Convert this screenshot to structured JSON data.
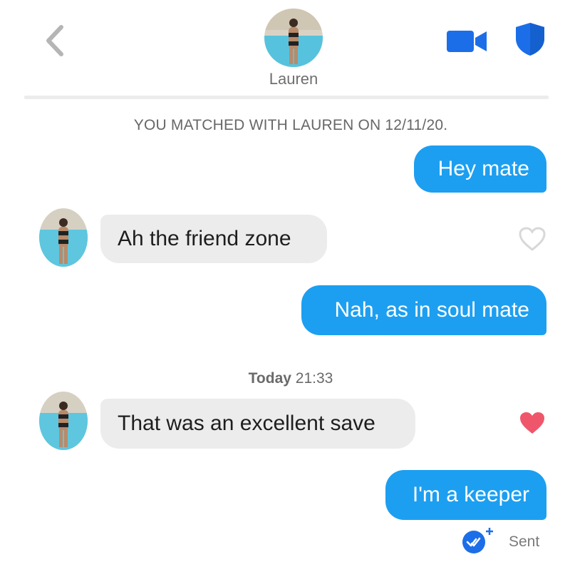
{
  "header": {
    "name": "Lauren",
    "icons": [
      "back-chevron-icon",
      "video-call-icon",
      "safety-shield-icon"
    ],
    "accent_color": "#1c6ee8"
  },
  "match_note": "YOU MATCHED WITH LAUREN ON 12/11/20.",
  "messages": [
    {
      "sender": "me",
      "text": "Hey mate"
    },
    {
      "sender": "Lauren",
      "text": "Ah the friend zone",
      "liked": false
    },
    {
      "sender": "me",
      "text": "Nah, as in soul mate"
    },
    {
      "sender": "Lauren",
      "text": "That was an excellent save",
      "liked": true
    },
    {
      "sender": "me",
      "text": "I'm a keeper"
    }
  ],
  "timestamp": {
    "day": "Today",
    "time": "21:33"
  },
  "status": {
    "label": "Sent",
    "icon": "read-receipt-check-icon"
  },
  "colors": {
    "outgoing_bubble": "#1c9ff1",
    "incoming_bubble": "#ececec",
    "like_heart": "#f0566b"
  }
}
